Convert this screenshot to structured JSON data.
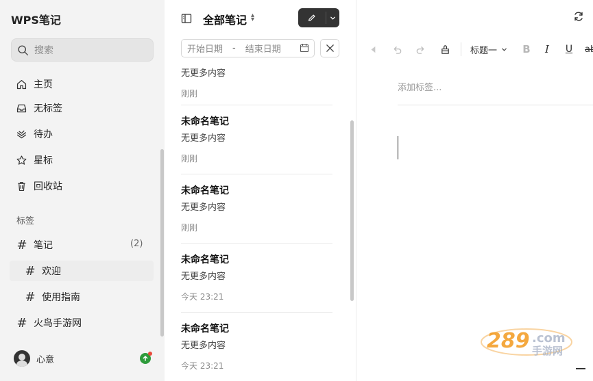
{
  "app": {
    "title": "WPS笔记"
  },
  "search": {
    "placeholder": "搜索"
  },
  "nav": {
    "home": "主页",
    "untagged": "无标签",
    "todo": "待办",
    "starred": "星标",
    "trash": "回收站"
  },
  "tags": {
    "section_label": "标签",
    "items": [
      {
        "label": "笔记",
        "count": "(2)"
      },
      {
        "label": "欢迎"
      },
      {
        "label": "使用指南"
      },
      {
        "label": "火鸟手游网"
      }
    ]
  },
  "user": {
    "name": "心意"
  },
  "list": {
    "title": "全部笔记",
    "start_date_placeholder": "开始日期",
    "date_separator": "-",
    "end_date_placeholder": "结束日期",
    "notes": [
      {
        "title": "",
        "preview": "无更多内容",
        "time": "刚刚"
      },
      {
        "title": "未命名笔记",
        "preview": "无更多内容",
        "time": "刚刚"
      },
      {
        "title": "未命名笔记",
        "preview": "无更多内容",
        "time": "刚刚"
      },
      {
        "title": "未命名笔记",
        "preview": "无更多内容",
        "time": "今天 23:21"
      },
      {
        "title": "未命名笔记",
        "preview": "无更多内容",
        "time": "今天 23:21"
      }
    ]
  },
  "editor": {
    "heading_selector": "标题一",
    "bold": "B",
    "italic": "I",
    "underline": "U",
    "strikethrough": "ab",
    "tag_placeholder": "添加标签..."
  },
  "watermark": {
    "line1": "289.com",
    "line2": "手游网"
  },
  "colors": {
    "accent_dark": "#333333",
    "upload_green": "#2e9b3b",
    "notify_red": "#e84a3c",
    "watermark_orange": "#f39a1e"
  }
}
